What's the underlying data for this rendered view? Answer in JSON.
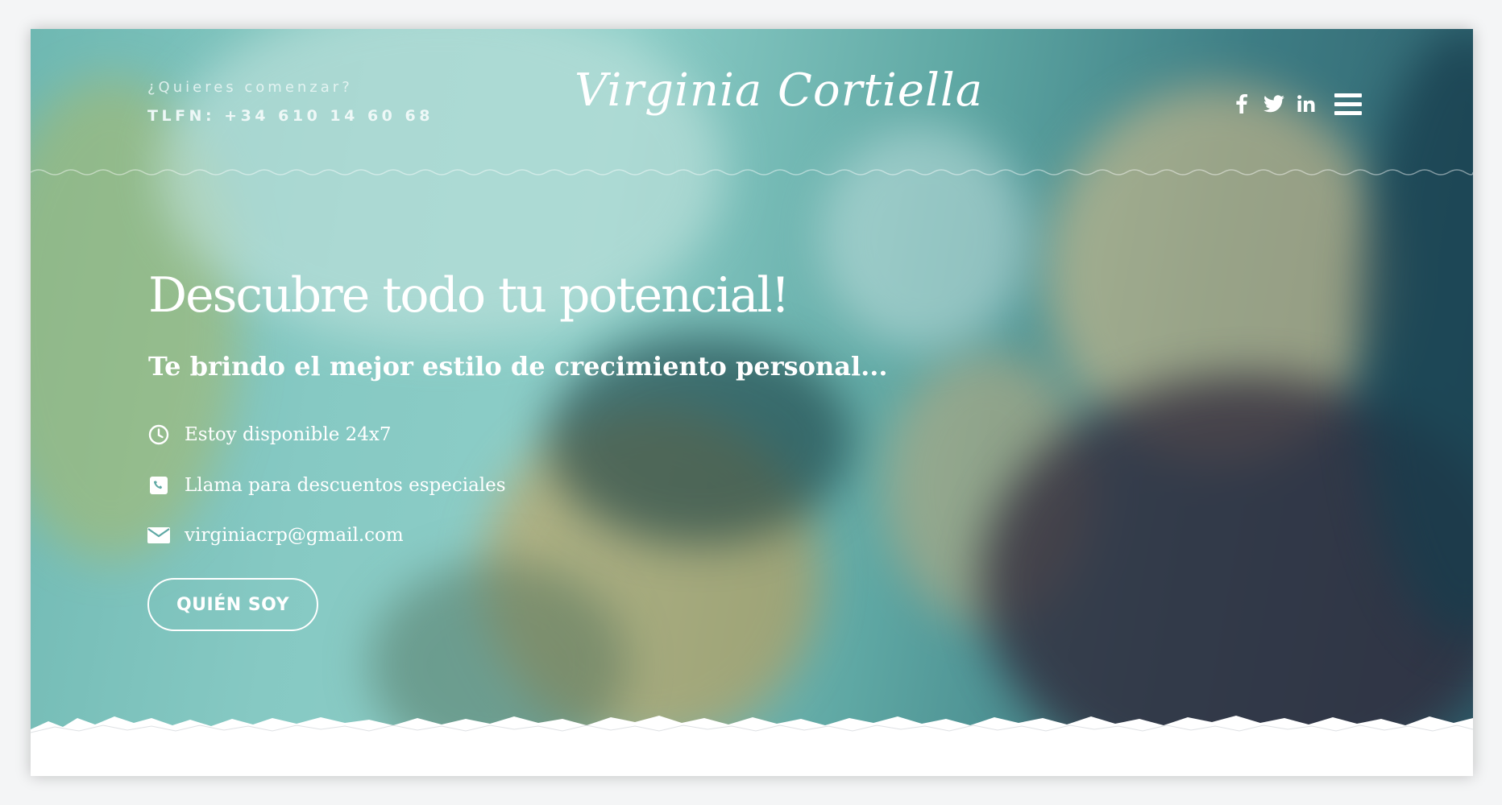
{
  "header": {
    "question": "¿Quieres comenzar?",
    "phone": "TLFN: +34 610 14 60 68",
    "logo": "Virginia Cortiella",
    "social": [
      "facebook-icon",
      "twitter-icon",
      "linkedin-icon"
    ],
    "menu_icon": "hamburger-menu-icon"
  },
  "hero": {
    "headline": "Descubre todo tu potencial!",
    "subheadline": "Te brindo el mejor estilo de crecimiento personal...",
    "features": [
      {
        "icon": "clock-icon",
        "text": "Estoy disponible 24x7"
      },
      {
        "icon": "phone-icon",
        "text": "Llama para descuentos especiales"
      },
      {
        "icon": "envelope-icon",
        "text": "virginiacrp@gmail.com"
      }
    ],
    "cta_label": "QUIÉN SOY"
  },
  "colors": {
    "text": "#ffffff",
    "overlay": "#6fb8b2",
    "background": "#ffffff"
  }
}
